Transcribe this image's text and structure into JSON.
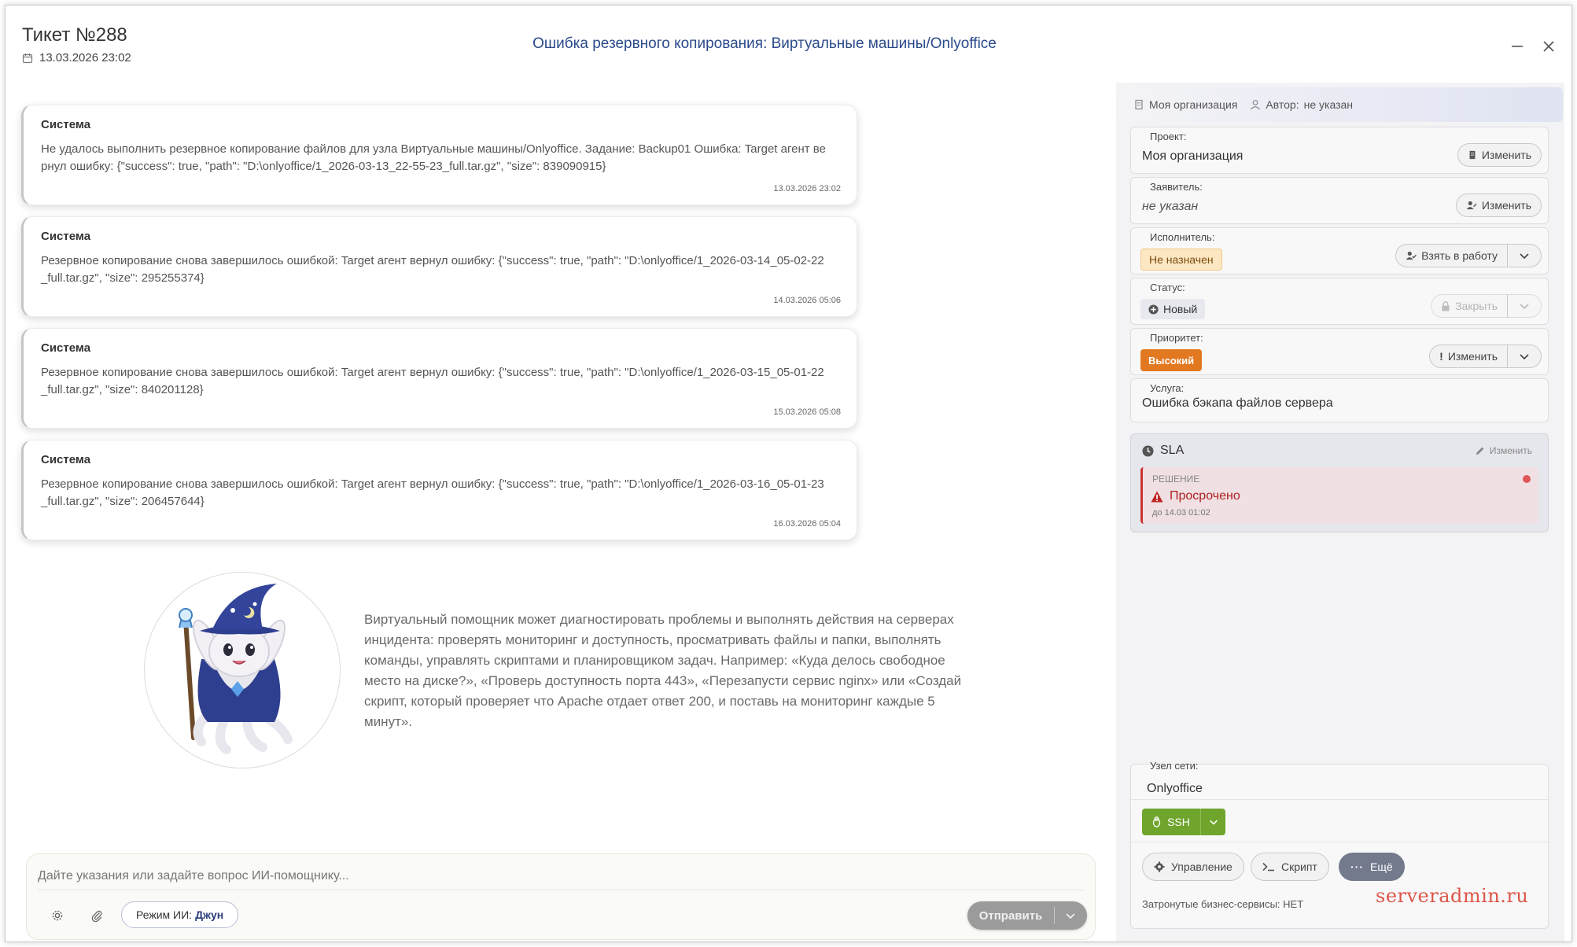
{
  "header": {
    "ticket_title": "Тикет №288",
    "ticket_date": "13.03.2026 23:02",
    "subject": "Ошибка резервного копирования: Виртуальные машины/Onlyoffice",
    "minimize_label": "—",
    "close_label": "✕"
  },
  "messages": [
    {
      "author": "Система",
      "text": "Не удалось выполнить резервное копирование файлов для узла Виртуальные машины/Onlyoffice. Задание: Backup01 Ошибка: Target агент вернул ошибку: {\"success\": true, \"path\": \"D:\\onlyoffice/1_2026-03-13_22-55-23_full.tar.gz\", \"size\": 839090915}",
      "time": "13.03.2026 23:02"
    },
    {
      "author": "Система",
      "text": "Резервное копирование снова завершилось ошибкой: Target агент вернул ошибку: {\"success\": true, \"path\": \"D:\\onlyoffice/1_2026-03-14_05-02-22_full.tar.gz\", \"size\": 295255374}",
      "time": "14.03.2026 05:06"
    },
    {
      "author": "Система",
      "text": "Резервное копирование снова завершилось ошибкой: Target агент вернул ошибку: {\"success\": true, \"path\": \"D:\\onlyoffice/1_2026-03-15_05-01-22_full.tar.gz\", \"size\": 840201128}",
      "time": "15.03.2026 05:08"
    },
    {
      "author": "Система",
      "text": "Резервное копирование снова завершилось ошибкой: Target агент вернул ошибку: {\"success\": true, \"path\": \"D:\\onlyoffice/1_2026-03-16_05-01-23_full.tar.gz\", \"size\": 206457644}",
      "time": "16.03.2026 05:04"
    }
  ],
  "assistant": {
    "description": "Виртуальный помощник может диагностировать проблемы и выполнять действия на серверах инцидента: проверять мониторинг и доступность, просматривать файлы и папки, выполнять команды, управлять скриптами и планировщиком задач. Например: «Куда делось свободное место на диске?», «Проверь доступность порта 443», «Перезапусти сервис nginx» или «Создай скрипт, который проверяет что Apache отдает ответ 200, и поставь на мониторинг каждые 5 минут»."
  },
  "chat": {
    "placeholder": "Дайте указания или задайте вопрос ИИ-помощнику...",
    "mode_prefix": "Режим ИИ:",
    "mode_name": "Джун",
    "send_label": "Отправить"
  },
  "panel": {
    "organization": "Моя организация",
    "author_label": "Автор:",
    "author_value": "не указан",
    "project": {
      "label": "Проект:",
      "value": "Моя организация",
      "button": "Изменить"
    },
    "requester": {
      "label": "Заявитель:",
      "value": "не указан",
      "button": "Изменить"
    },
    "assignee": {
      "label": "Исполнитель:",
      "value": "Не назначен",
      "button": "Взять в работу"
    },
    "status": {
      "label": "Статус:",
      "value": "Новый",
      "button": "Закрыть"
    },
    "priority": {
      "label": "Приоритет:",
      "value": "Высокий",
      "button": "Изменить"
    },
    "service": {
      "label": "Услуга:",
      "value": "Ошибка бэкапа файлов сервера"
    },
    "sla": {
      "title": "SLA",
      "edit_label": "Изменить",
      "kind": "РЕШЕНИЕ",
      "state": "Просрочено",
      "due": "до 14.03 01:02"
    },
    "node": {
      "label": "Узел сети:",
      "value": "Onlyoffice",
      "ssh_label": "SSH",
      "manage_label": "Управление",
      "script_label": "Скрипт",
      "more_label": "Ещё",
      "business_services": "Затронутые бизнес-сервисы: НЕТ"
    }
  },
  "watermark": "serveradmin.ru",
  "colors": {
    "subject": "#2a4a8a",
    "priority_high": "#e27820",
    "ssh_green": "#6fa52d",
    "overdue_red": "#b02020",
    "watermark": "#d83a2a"
  }
}
